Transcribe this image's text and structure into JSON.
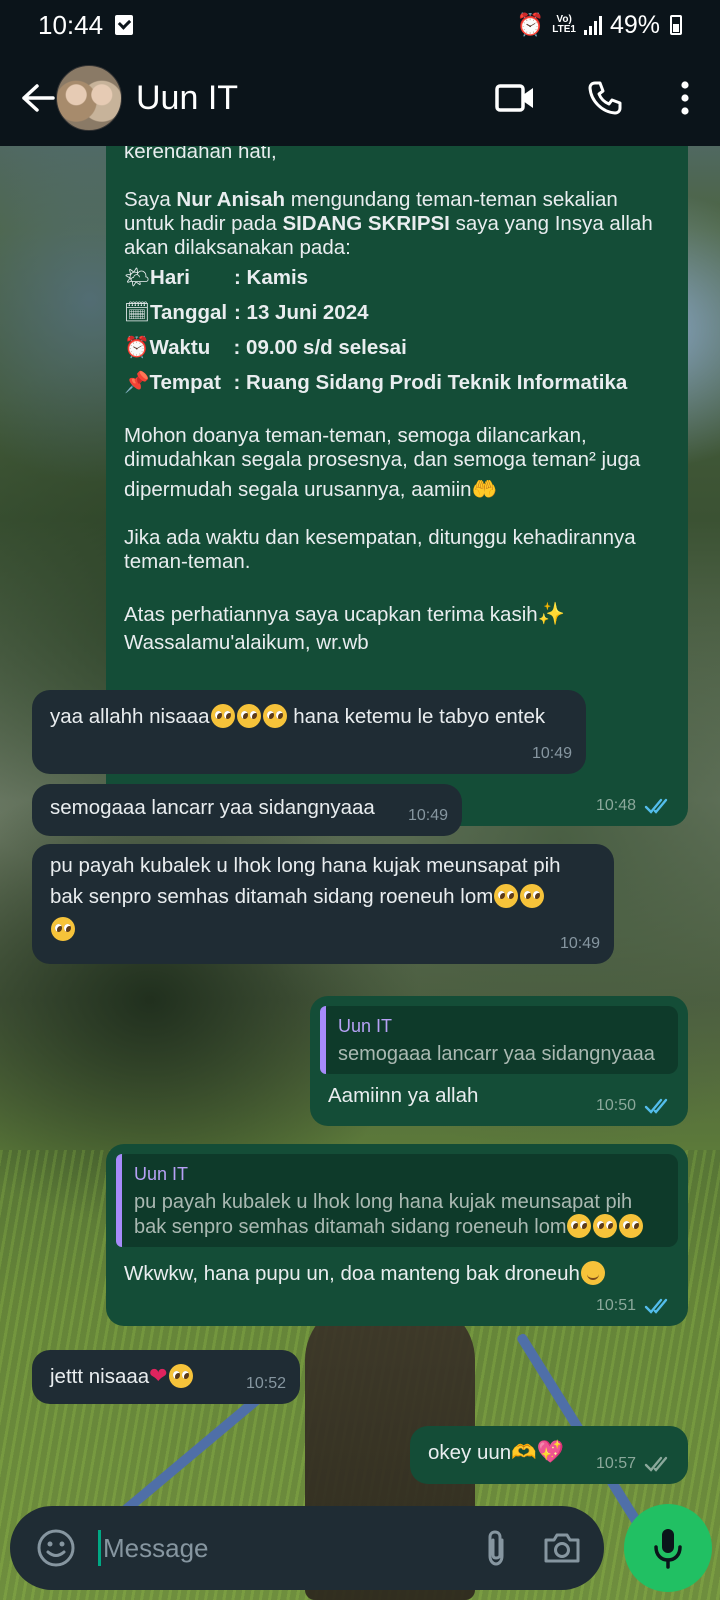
{
  "status_bar": {
    "time": "10:44",
    "volte_top": "Vo)",
    "volte_bottom": "LTE1",
    "battery": "49%"
  },
  "header": {
    "contact_name": "Uun IT"
  },
  "invitation": {
    "line_top": "kerendahan hati,",
    "intro_a": "Saya ",
    "intro_name": "Nur Anisah",
    "intro_b": " mengundang teman-teman sekalian",
    "intro_line2a": "untuk hadir pada ",
    "intro_event": "SIDANG SKRIPSI",
    "intro_line2b": " saya yang Insya allah",
    "intro_line3": "akan dilaksanakan pada:",
    "details": [
      {
        "icon": "sun-cloud-icon",
        "label": "Hari",
        "value": ": Kamis"
      },
      {
        "icon": "calendar-icon",
        "label": "Tanggal",
        "value": ": 13 Juni 2024"
      },
      {
        "icon": "alarm-clock-icon",
        "label": "Waktu",
        "value": ": 09.00 s/d selesai"
      },
      {
        "icon": "pushpin-icon",
        "label": "Tempat",
        "value": ": Ruang Sidang Prodi Teknik Informatika"
      }
    ],
    "para1_l1": "Mohon doanya teman-teman, semoga dilancarkan,",
    "para1_l2": "dimudahkan segala prosesnya, dan semoga teman² juga",
    "para1_l3": "dipermudah segala urusannya, aamiin",
    "para2_l1": "Jika ada waktu dan kesempatan, ditunggu kehadirannya",
    "para2_l2": "teman-teman.",
    "para3_l1": "Atas perhatiannya saya ucapkan terima kasih",
    "para3_l2": "Wassalamu'alaikum, wr.wb",
    "time": "10:48"
  },
  "messages": {
    "m1": {
      "text": "yaa allahh nisaaa",
      "text_b": " hana ketemu le tabyo entek",
      "time": "10:49"
    },
    "m2": {
      "text": "semogaaa lancarr yaa sidangnyaaa",
      "time": "10:49"
    },
    "m3": {
      "l1": "pu payah kubalek u lhok long hana kujak meunsapat pih",
      "l2": "bak senpro semhas ditamah sidang roeneuh lom",
      "time": "10:49"
    },
    "m4": {
      "quote_author": "Uun IT",
      "quote_text": "semogaaa lancarr yaa sidangnyaaa",
      "text": "Aamiinn ya allah",
      "time": "10:50"
    },
    "m5": {
      "quote_author": "Uun IT",
      "quote_l1": "pu payah kubalek u lhok long hana kujak meunsapat pih",
      "quote_l2": "bak senpro semhas ditamah sidang roeneuh lom",
      "text": "Wkwkw, hana pupu un, doa manteng bak droneuh",
      "time": "10:51"
    },
    "m6": {
      "text": "jettt nisaaa",
      "time": "10:52"
    },
    "m7": {
      "text": "okey uun",
      "time": "10:57"
    }
  },
  "input": {
    "placeholder": "Message"
  },
  "colors": {
    "outgoing_bubble": "#144d37",
    "incoming_bubble": "#1f2c34",
    "read_ticks": "#53bdeb",
    "mic_button": "#21c063",
    "header": "#0b141a"
  }
}
